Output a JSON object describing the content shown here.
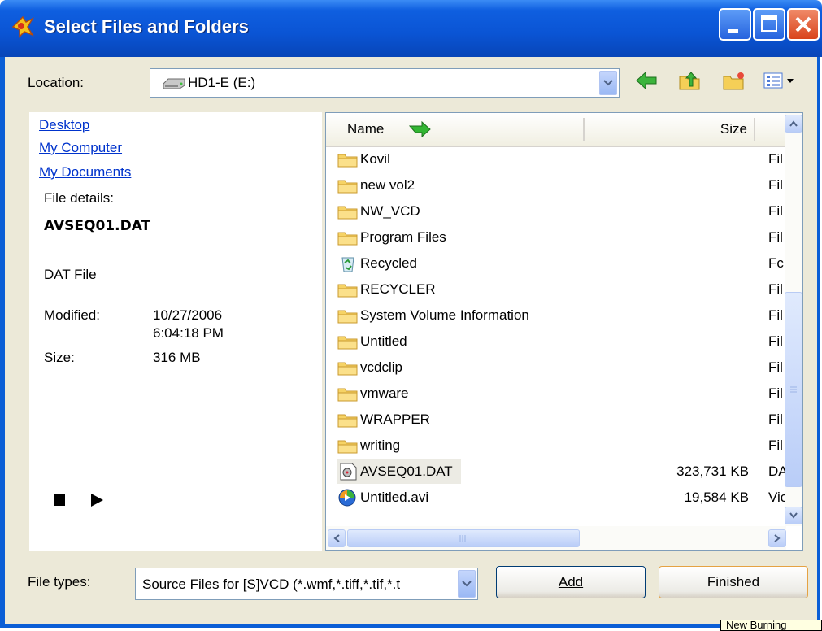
{
  "window": {
    "title": "Select Files and Folders"
  },
  "location": {
    "label": "Location:",
    "value": "HD1-E (E:)"
  },
  "places": [
    {
      "label": "Desktop"
    },
    {
      "label": "My Computer"
    },
    {
      "label": "My Documents"
    }
  ],
  "details": {
    "heading": "File details:",
    "filename": "AVSEQ01.DAT",
    "filetype": "DAT File",
    "modified_label": "Modified:",
    "modified_date": "10/27/2006",
    "modified_time": "6:04:18 PM",
    "size_label": "Size:",
    "size_value": "316 MB"
  },
  "file_list": {
    "columns": {
      "name": "Name",
      "size": "Size"
    },
    "rows": [
      {
        "name": "Kovil",
        "size": "",
        "type": "Fil",
        "icon": "folder-icon"
      },
      {
        "name": "new vol2",
        "size": "",
        "type": "Fil",
        "icon": "folder-icon"
      },
      {
        "name": "NW_VCD",
        "size": "",
        "type": "Fil",
        "icon": "folder-icon"
      },
      {
        "name": "Program Files",
        "size": "",
        "type": "Fil",
        "icon": "folder-icon"
      },
      {
        "name": "Recycled",
        "size": "",
        "type": "Fc",
        "icon": "recycle-bin-icon"
      },
      {
        "name": "RECYCLER",
        "size": "",
        "type": "Fil",
        "icon": "folder-icon"
      },
      {
        "name": "System Volume Information",
        "size": "",
        "type": "Fil",
        "icon": "folder-icon"
      },
      {
        "name": "Untitled",
        "size": "",
        "type": "Fil",
        "icon": "folder-icon"
      },
      {
        "name": "vcdclip",
        "size": "",
        "type": "Fil",
        "icon": "folder-icon"
      },
      {
        "name": "vmware",
        "size": "",
        "type": "Fil",
        "icon": "folder-icon"
      },
      {
        "name": "WRAPPER",
        "size": "",
        "type": "Fil",
        "icon": "folder-icon"
      },
      {
        "name": "writing",
        "size": "",
        "type": "Fil",
        "icon": "folder-icon"
      },
      {
        "name": "AVSEQ01.DAT",
        "size": "323,731 KB",
        "type": "DA",
        "icon": "media-file-icon",
        "selected": true
      },
      {
        "name": "Untitled.avi",
        "size": "19,584 KB",
        "type": "Vic",
        "icon": "media-player-icon"
      }
    ]
  },
  "file_types": {
    "label": "File types:",
    "value": "Source Files for [S]VCD  (*.wmf,*.tiff,*.tif,*.t"
  },
  "buttons": {
    "add": "Add",
    "finished": "Finished"
  },
  "tooltip": "New Burning"
}
